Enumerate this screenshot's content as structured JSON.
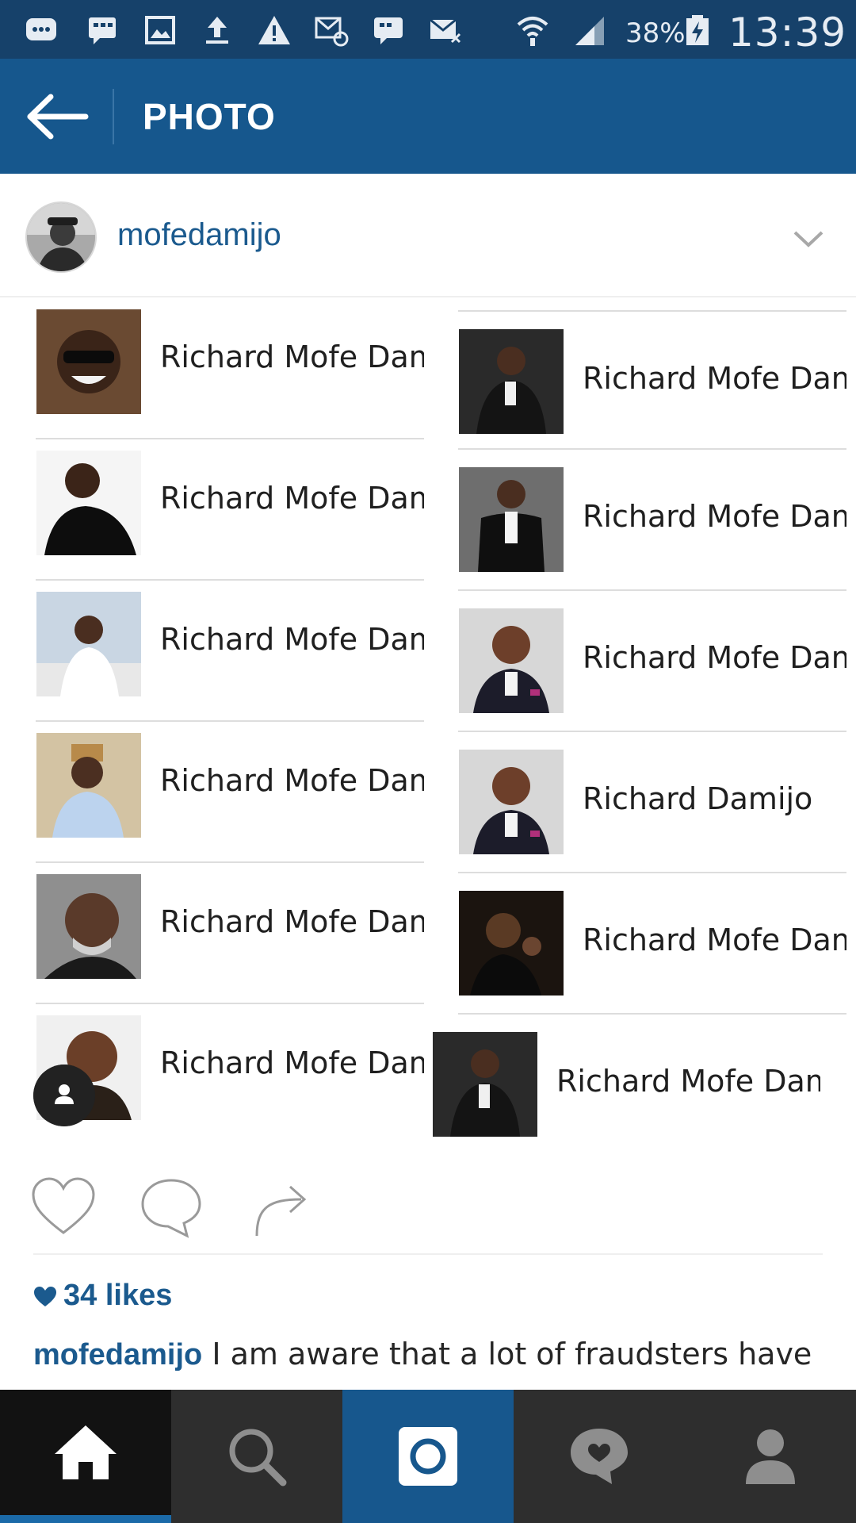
{
  "status_bar": {
    "battery_percent": "38%",
    "time": "13:39",
    "icons": [
      "bbm-icon",
      "chat-icon",
      "image-icon",
      "upload-icon",
      "warning-icon",
      "email-icon",
      "message-icon",
      "mail-blocked-icon",
      "wifi-icon",
      "signal-icon",
      "battery-charging-icon"
    ]
  },
  "app_bar": {
    "title": "PHOTO",
    "back_icon": "arrow-left-icon"
  },
  "post": {
    "username": "mofedamijo",
    "menu_icon": "chevron-down-icon",
    "results_left": [
      {
        "name": "Richard Mofe Dam"
      },
      {
        "name": "Richard Mofe Dam"
      },
      {
        "name": "Richard Mofe Dam"
      },
      {
        "name": "Richard Mofe Dam"
      },
      {
        "name": "Richard Mofe Dam"
      },
      {
        "name": "Richard Mofe Dam"
      }
    ],
    "results_right": [
      {
        "name": "Richard Mofe Dam"
      },
      {
        "name": "Richard Mofe Dam"
      },
      {
        "name": "Richard Mofe Dam"
      },
      {
        "name": "Richard Damijo"
      },
      {
        "name": "Richard Mofe Dam"
      },
      {
        "name": "Richard Mofe Dam"
      }
    ],
    "likes": "34 likes",
    "caption_user": "mofedamijo",
    "caption_text": " I am aware that a lot of fraudsters have"
  },
  "actions": [
    "heart-icon",
    "comment-icon",
    "share-icon"
  ],
  "bottom_nav": [
    "home-icon",
    "search-icon",
    "camera-icon",
    "activity-icon",
    "profile-icon"
  ],
  "colors": {
    "status_bar": "#16416a",
    "app_bar": "#16578d",
    "link_blue": "#1b5a8e",
    "nav_bg": "#2e2e2e"
  }
}
